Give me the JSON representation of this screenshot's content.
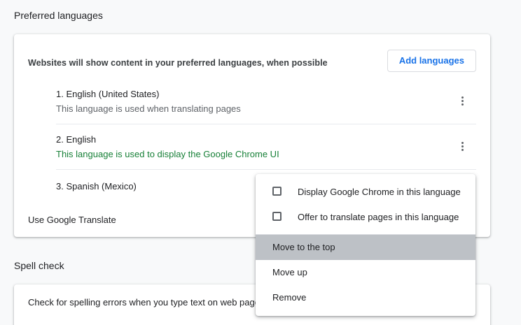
{
  "sections": {
    "preferred_languages_title": "Preferred languages",
    "spell_check_title": "Spell check"
  },
  "languages_card": {
    "description": "Websites will show content in your preferred languages, when possible",
    "add_button_label": "Add languages",
    "languages": [
      {
        "name": "1. English (United States)",
        "subtitle": "This language is used when translating pages"
      },
      {
        "name": "2. English",
        "subtitle": "This language is used to display the Google Chrome UI"
      },
      {
        "name": "3. Spanish (Mexico)",
        "subtitle": ""
      }
    ],
    "translate_label": "Use Google Translate"
  },
  "spell_card": {
    "description": "Check for spelling errors when you type text on web pages"
  },
  "context_menu": {
    "checks": [
      {
        "label": "Display Google Chrome in this language",
        "checked": false
      },
      {
        "label": "Offer to translate pages in this language",
        "checked": false
      }
    ],
    "items": [
      {
        "label": "Move to the top",
        "highlighted": true
      },
      {
        "label": "Move up",
        "highlighted": false
      },
      {
        "label": "Remove",
        "highlighted": false
      }
    ]
  },
  "colors": {
    "accent": "#1a73e8",
    "green_text": "#188038",
    "menu_highlight": "#bdc1c6"
  }
}
